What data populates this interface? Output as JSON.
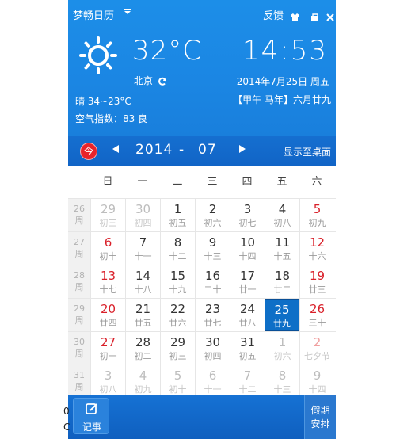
{
  "app": {
    "title": "梦畅日历",
    "feedback": "反馈"
  },
  "weather": {
    "temperature": "32°C",
    "city": "北京",
    "description": "晴 34~23°C",
    "aqi": "空气指数：83 良",
    "icon": "sun-icon"
  },
  "clock": {
    "time": "14:53",
    "date": "2014年7月25日 周五",
    "lunar": "【甲午 马年】六月廿九"
  },
  "nav": {
    "today": "今",
    "year": "2014",
    "separator": "-",
    "month": "07",
    "desktop": "显示至桌面"
  },
  "calendar": {
    "weekdays": [
      "日",
      "一",
      "二",
      "三",
      "四",
      "五",
      "六"
    ],
    "week_label": "周",
    "weeks": [
      {
        "num": "26",
        "days": [
          {
            "d": "29",
            "l": "初三",
            "s": "dim"
          },
          {
            "d": "30",
            "l": "初四",
            "s": "dim"
          },
          {
            "d": "1",
            "l": "初五",
            "s": "norm"
          },
          {
            "d": "2",
            "l": "初六",
            "s": "norm"
          },
          {
            "d": "3",
            "l": "初七",
            "s": "norm"
          },
          {
            "d": "4",
            "l": "初八",
            "s": "norm"
          },
          {
            "d": "5",
            "l": "初九",
            "s": "red"
          }
        ]
      },
      {
        "num": "27",
        "days": [
          {
            "d": "6",
            "l": "初十",
            "s": "red"
          },
          {
            "d": "7",
            "l": "十一",
            "s": "norm"
          },
          {
            "d": "8",
            "l": "十二",
            "s": "norm"
          },
          {
            "d": "9",
            "l": "十三",
            "s": "norm"
          },
          {
            "d": "10",
            "l": "十四",
            "s": "norm"
          },
          {
            "d": "11",
            "l": "十五",
            "s": "norm"
          },
          {
            "d": "12",
            "l": "十六",
            "s": "red"
          }
        ]
      },
      {
        "num": "28",
        "days": [
          {
            "d": "13",
            "l": "十七",
            "s": "red"
          },
          {
            "d": "14",
            "l": "十八",
            "s": "norm"
          },
          {
            "d": "15",
            "l": "十九",
            "s": "norm"
          },
          {
            "d": "16",
            "l": "二十",
            "s": "norm"
          },
          {
            "d": "17",
            "l": "廿一",
            "s": "norm"
          },
          {
            "d": "18",
            "l": "廿二",
            "s": "norm"
          },
          {
            "d": "19",
            "l": "廿三",
            "s": "red"
          }
        ]
      },
      {
        "num": "29",
        "days": [
          {
            "d": "20",
            "l": "廿四",
            "s": "red"
          },
          {
            "d": "21",
            "l": "廿五",
            "s": "norm"
          },
          {
            "d": "22",
            "l": "廿六",
            "s": "norm"
          },
          {
            "d": "23",
            "l": "廿七",
            "s": "norm"
          },
          {
            "d": "24",
            "l": "廿八",
            "s": "norm"
          },
          {
            "d": "25",
            "l": "廿九",
            "s": "sel"
          },
          {
            "d": "26",
            "l": "三十",
            "s": "red"
          }
        ]
      },
      {
        "num": "30",
        "days": [
          {
            "d": "27",
            "l": "初一",
            "s": "red"
          },
          {
            "d": "28",
            "l": "初二",
            "s": "norm"
          },
          {
            "d": "29",
            "l": "初三",
            "s": "norm"
          },
          {
            "d": "30",
            "l": "初四",
            "s": "norm"
          },
          {
            "d": "31",
            "l": "初五",
            "s": "norm"
          },
          {
            "d": "1",
            "l": "初六",
            "s": "dim"
          },
          {
            "d": "2",
            "l": "七夕节",
            "s": "dimred"
          }
        ]
      },
      {
        "num": "31",
        "days": [
          {
            "d": "3",
            "l": "初八",
            "s": "dim"
          },
          {
            "d": "4",
            "l": "初九",
            "s": "dim"
          },
          {
            "d": "5",
            "l": "初十",
            "s": "dim"
          },
          {
            "d": "6",
            "l": "十一",
            "s": "dim"
          },
          {
            "d": "7",
            "l": "十二",
            "s": "dim"
          },
          {
            "d": "8",
            "l": "十三",
            "s": "dim"
          },
          {
            "d": "9",
            "l": "十四",
            "s": "dim"
          }
        ]
      }
    ]
  },
  "footer": {
    "note": "记事",
    "holiday_line1": "假期",
    "holiday_line2": "安排"
  },
  "stray": {
    "a": "0",
    "b": "C"
  },
  "colors": {
    "header_blue": "#1b86e3",
    "selected_blue": "#0e6fc7",
    "weekend_red": "#d9202a",
    "today_red": "#e8232a"
  }
}
